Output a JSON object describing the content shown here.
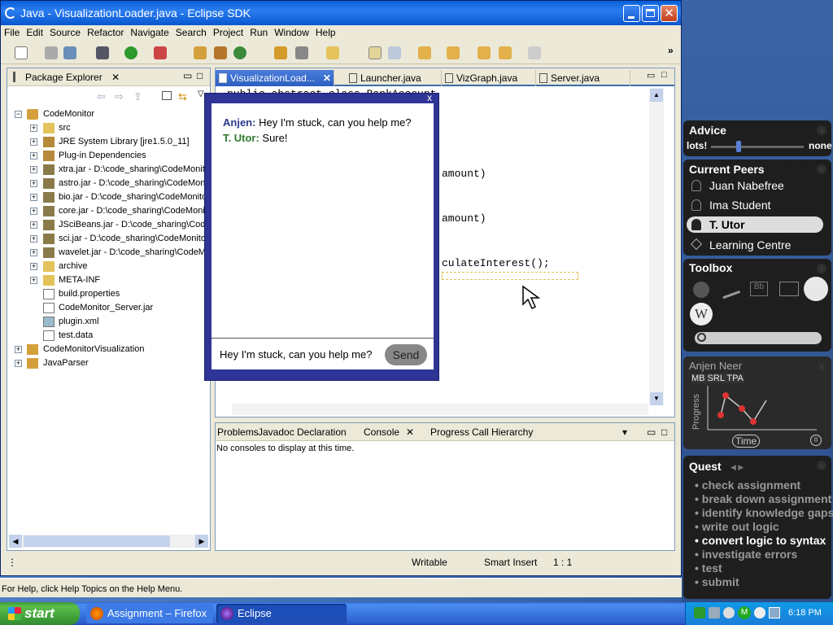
{
  "window": {
    "title": "Java - VisualizationLoader.java - Eclipse SDK"
  },
  "menu": [
    "File",
    "Edit",
    "Source",
    "Refactor",
    "Navigate",
    "Search",
    "Project",
    "Run",
    "Window",
    "Help"
  ],
  "package_explorer": {
    "title": "Package Explorer",
    "root": "CodeMonitor",
    "items": [
      "src",
      "JRE System Library [jre1.5.0_11]",
      "Plug-in Dependencies",
      "xtra.jar - D:\\code_sharing\\CodeMonit",
      "astro.jar - D:\\code_sharing\\CodeMon",
      "bio.jar - D:\\code_sharing\\CodeMonito",
      "core.jar - D:\\code_sharing\\CodeMonit",
      "JSciBeans.jar - D:\\code_sharing\\Code",
      "sci.jar - D:\\code_sharing\\CodeMonito",
      "wavelet.jar - D:\\code_sharing\\CodeM",
      "archive",
      "META-INF",
      "build.properties",
      "CodeMonitor_Server.jar",
      "plugin.xml",
      "test.data"
    ],
    "projects": [
      "CodeMonitorVisualization",
      "JavaParser"
    ]
  },
  "editor": {
    "tabs": [
      "VisualizationLoad...",
      "Launcher.java",
      "VizGraph.java",
      "Server.java"
    ],
    "code_lines": [
      "public abstract class BankAccount",
      "amount)",
      "amount)",
      "culateInterest();"
    ]
  },
  "bottom_panel": {
    "tabs": [
      "Problems",
      "Javadoc",
      "Declaration",
      "Console",
      "Progress",
      "Call Hierarchy"
    ],
    "message": "No consoles to display at this time."
  },
  "status": {
    "writable": "Writable",
    "insert": "Smart Insert",
    "position": "1 : 1"
  },
  "help_text": "For Help, click Help Topics on the Help Menu.",
  "chat": {
    "close": "x",
    "messages": [
      {
        "speaker": "Anjen:",
        "text": "Hey I'm stuck, can you help me?"
      },
      {
        "speaker": "T. Utor:",
        "text": "Sure!"
      }
    ],
    "input_value": "Hey I'm stuck, can you help me?",
    "send_label": "Send"
  },
  "advice": {
    "title": "Advice",
    "left": "lots!",
    "right": "none",
    "level": 0.3
  },
  "peers": {
    "title": "Current Peers",
    "items": [
      "Juan Nabefree",
      "Ima Student",
      "T. Utor",
      "Learning Centre"
    ],
    "selected": "T. Utor"
  },
  "toolbox": {
    "title": "Toolbox"
  },
  "progress": {
    "name": "Anjen Neer",
    "tags": "MB SRL TPA",
    "ylabel": "Progress",
    "xlabel": "Time"
  },
  "quest": {
    "title": "Quest",
    "items": [
      "check assignment",
      "break down assignment",
      "identify knowledge gaps",
      "write out logic",
      "convert logic to syntax",
      "investigate errors",
      "test",
      "submit"
    ],
    "current": "convert logic to syntax"
  },
  "taskbar": {
    "start": "start",
    "tasks": [
      "Assignment – Firefox",
      "Eclipse"
    ],
    "clock": "6:18 PM"
  },
  "colors": {
    "chat_bg": "#2e3596",
    "anjen": "#2b3a8c",
    "tutor": "#2f7a2f"
  }
}
